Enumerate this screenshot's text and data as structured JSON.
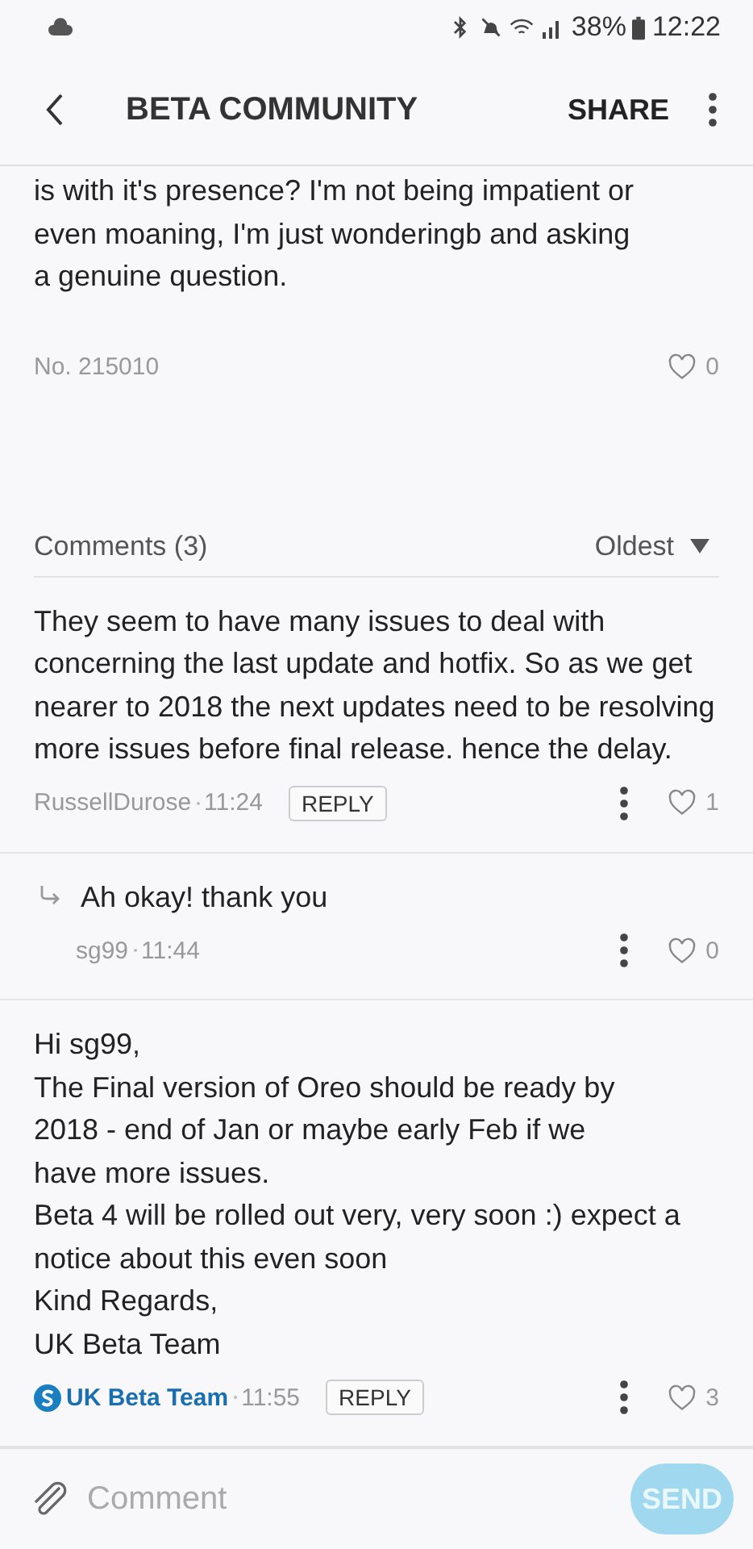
{
  "status_bar": {
    "battery": "38%",
    "time": "12:22"
  },
  "header": {
    "title": "BETA COMMUNITY",
    "action": "SHARE"
  },
  "post": {
    "lines": [
      "is with it's presence? I'm not being impatient or",
      "even moaning, I'm just wonderingb and asking",
      "a genuine question."
    ],
    "number": "No. 215010",
    "likes": "0"
  },
  "comments_header": {
    "title": "Comments (3)",
    "sort": "Oldest"
  },
  "comments": [
    {
      "kind": "comment",
      "lines": [
        "They seem to have many issues to deal with",
        "concerning the last update and hotfix.  So as we get",
        "nearer to 2018 the next updates need to be resolving",
        "more issues before final release. hence the delay."
      ],
      "author": "RussellDurose",
      "official": false,
      "time": "11:24",
      "reply": "REPLY",
      "likes": "1"
    },
    {
      "kind": "reply",
      "lines": [
        "Ah okay! thank you"
      ],
      "author": "sg99",
      "official": false,
      "time": "11:44",
      "likes": "0"
    },
    {
      "kind": "comment",
      "lines": [
        "Hi sg99,",
        "The Final version of Oreo should be ready by",
        "2018 - end of Jan or maybe early Feb if we",
        "have more issues.",
        "Beta 4 will be rolled out very, very soon :) expect a",
        "notice about this even soon",
        "Kind Regards,",
        "UK Beta Team"
      ],
      "author": "UK Beta Team",
      "official": true,
      "time": "11:55",
      "reply": "REPLY",
      "likes": "3"
    }
  ],
  "composer": {
    "placeholder": "Comment",
    "send": "SEND",
    "disabled": true
  }
}
